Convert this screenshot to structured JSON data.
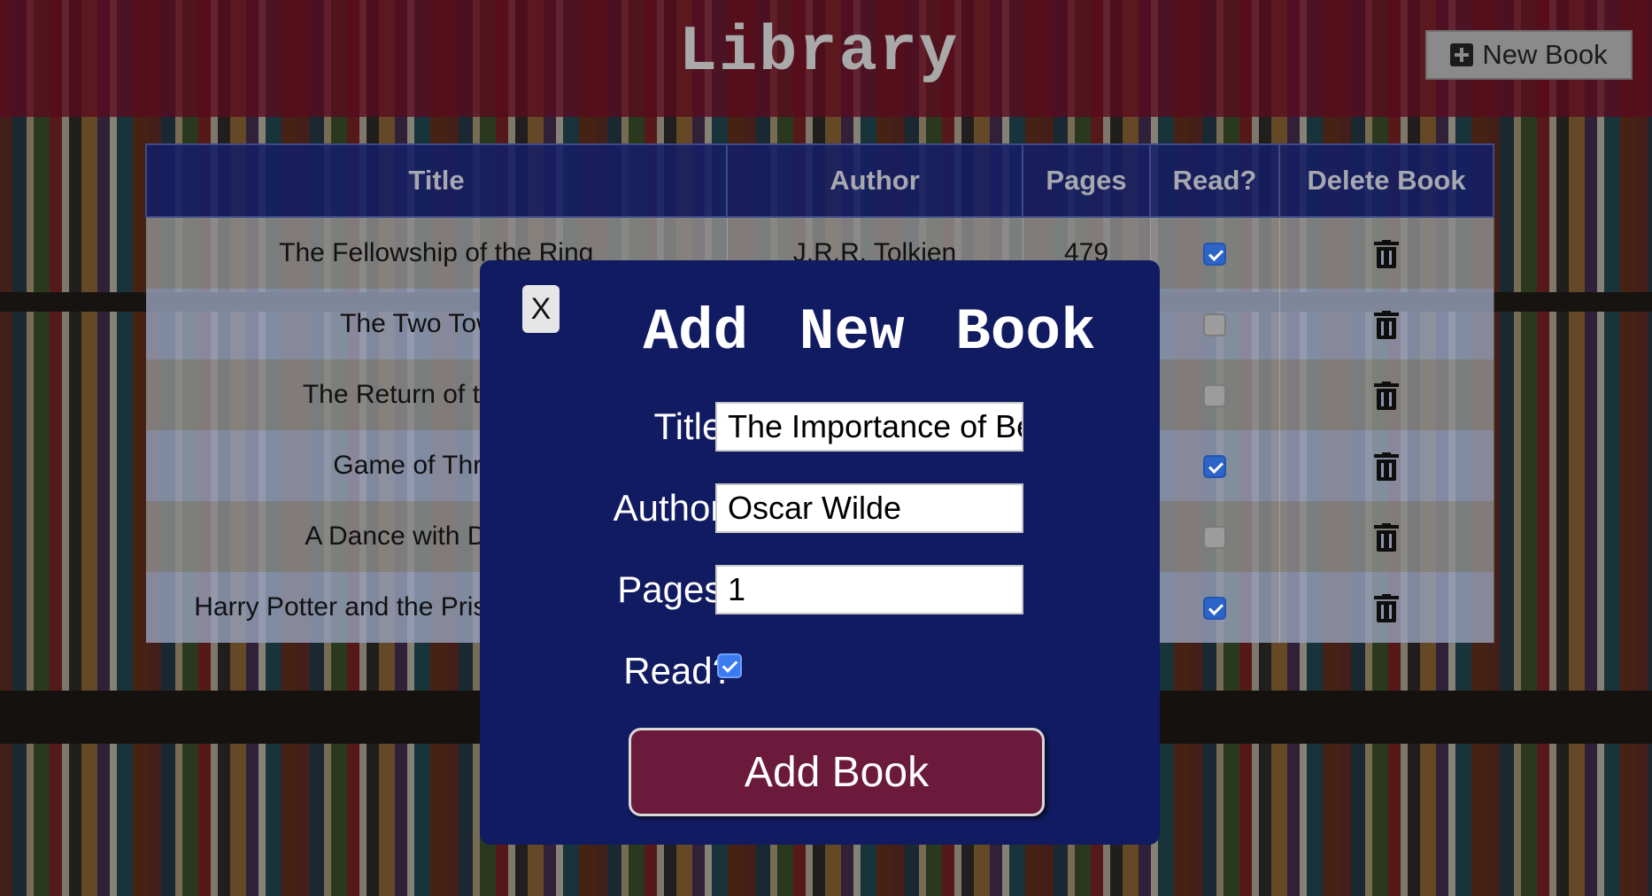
{
  "header": {
    "title": "Library",
    "new_book_label": "New Book",
    "new_book_icon": "plus-square-icon"
  },
  "table": {
    "columns": [
      "Title",
      "Author",
      "Pages",
      "Read?",
      "Delete Book"
    ],
    "rows": [
      {
        "title": "The Fellowship of the Ring",
        "author": "J.R.R. Tolkien",
        "pages": "479",
        "read": true
      },
      {
        "title": "The Two Towers",
        "author": "",
        "pages": "",
        "read": false
      },
      {
        "title": "The Return of the King",
        "author": "",
        "pages": "",
        "read": false
      },
      {
        "title": "Game of Thrones",
        "author": "",
        "pages": "",
        "read": true
      },
      {
        "title": "A Dance with Dragons",
        "author": "",
        "pages": "",
        "read": false
      },
      {
        "title": "Harry Potter and the Prisoner of Azkaban",
        "author": "",
        "pages": "",
        "read": true
      }
    ],
    "delete_icon": "trash-icon"
  },
  "modal": {
    "close_label": "X",
    "title": "Add New Book",
    "title_label": "Title:",
    "title_value": "The Importance of Being",
    "author_label": "Author:",
    "author_value": "Oscar Wilde",
    "pages_label": "Pages:",
    "pages_value": "1",
    "read_label": "Read?",
    "read_checked": true,
    "submit_label": "Add Book"
  },
  "colors": {
    "header_bg": "#5a0a1e",
    "table_header_bg": "#141e64",
    "modal_bg": "#111b62",
    "submit_bg": "#6b1a3b",
    "checkbox_checked": "#2c64c8"
  }
}
